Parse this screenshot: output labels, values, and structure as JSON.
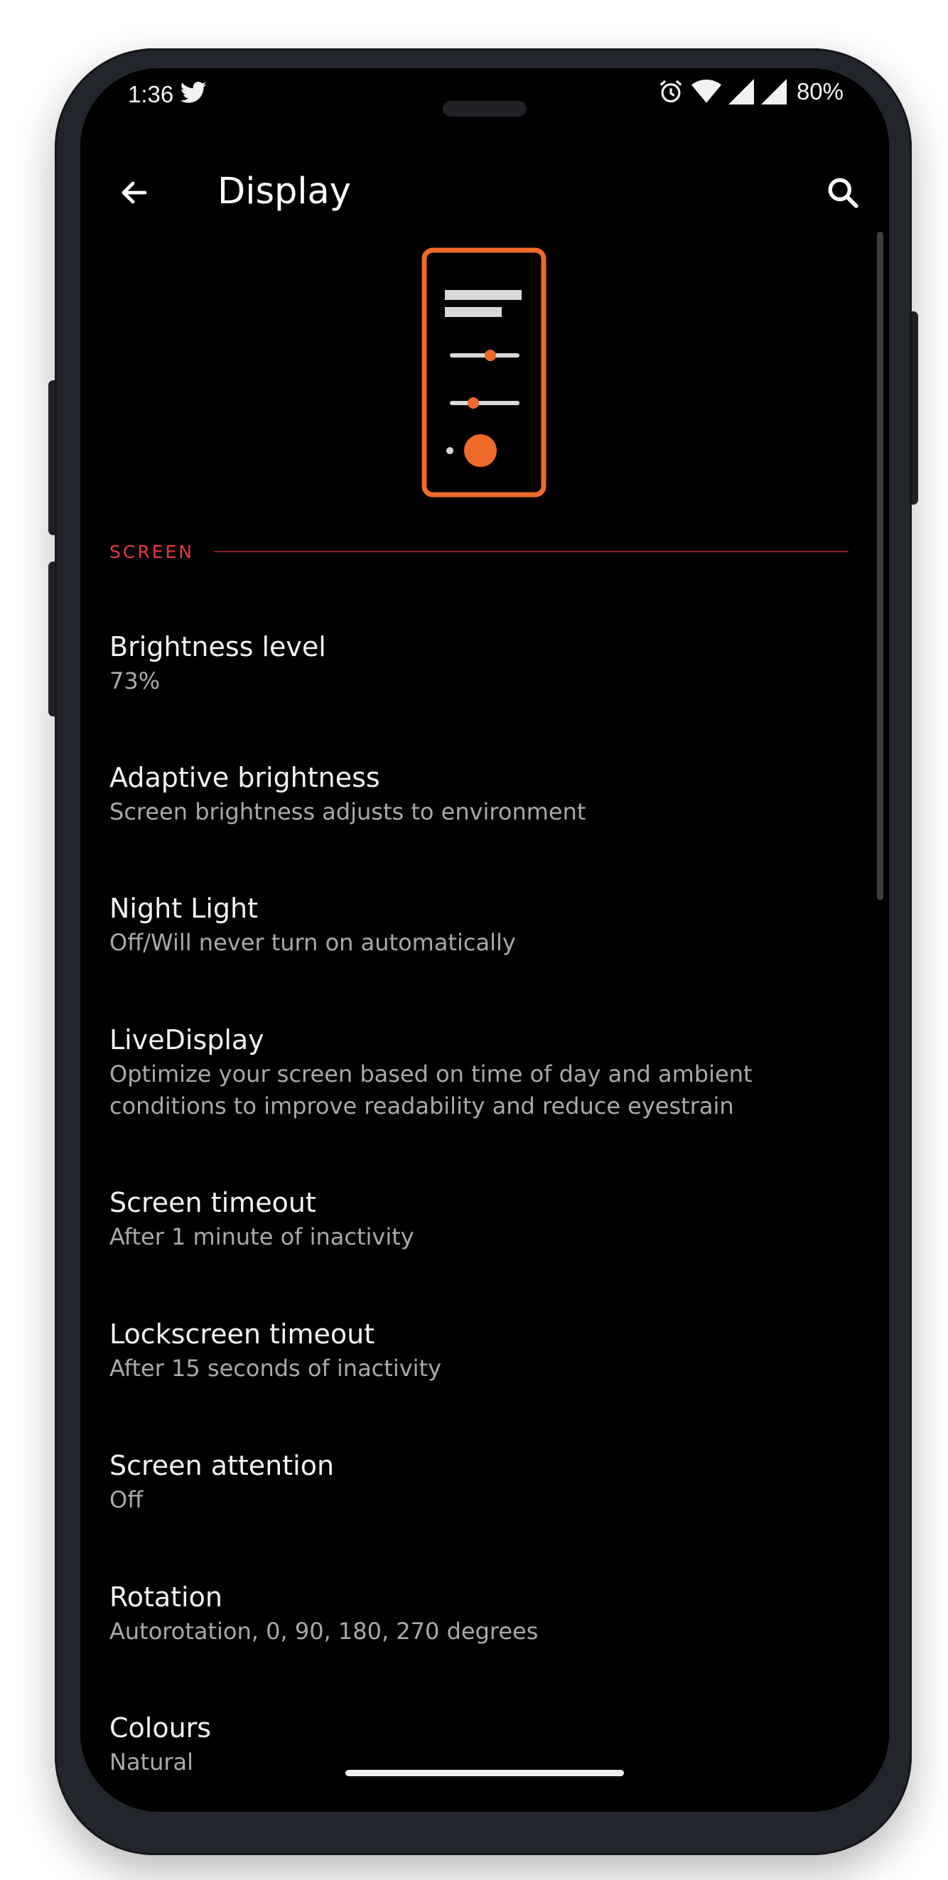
{
  "status_bar": {
    "time": "1:36",
    "left_icons": [
      "twitter-icon"
    ],
    "right_icons": [
      "alarm-icon",
      "wifi-icon",
      "signal-icon",
      "signal-icon"
    ],
    "battery": "80%"
  },
  "app_bar": {
    "title": "Display",
    "back_icon": "arrow-back-icon",
    "search_icon": "search-icon"
  },
  "section": {
    "title": "SCREEN",
    "color": "#e8383f"
  },
  "illustration": {
    "accent_color": "#f06a2a",
    "icon": "display-settings-illustration"
  },
  "settings": [
    {
      "title": "Brightness level",
      "summary": "73%"
    },
    {
      "title": "Adaptive brightness",
      "summary": "Screen brightness adjusts to environment"
    },
    {
      "title": "Night Light",
      "summary": "Off/Will never turn on automatically"
    },
    {
      "title": "LiveDisplay",
      "summary": "Optimize your screen based on time of day and ambient conditions to improve readability and reduce eyestrain"
    },
    {
      "title": "Screen timeout",
      "summary": "After 1 minute of inactivity"
    },
    {
      "title": "Lockscreen timeout",
      "summary": "After 15 seconds of inactivity"
    },
    {
      "title": "Screen attention",
      "summary": "Off"
    },
    {
      "title": "Rotation",
      "summary": "Autorotation, 0, 90, 180, 270 degrees"
    },
    {
      "title": "Colours",
      "summary": "Natural"
    }
  ],
  "colors": {
    "background": "#000000",
    "title_text": "#f2f2f2",
    "summary_text": "#a9a9a9",
    "frame": "#23252c"
  }
}
